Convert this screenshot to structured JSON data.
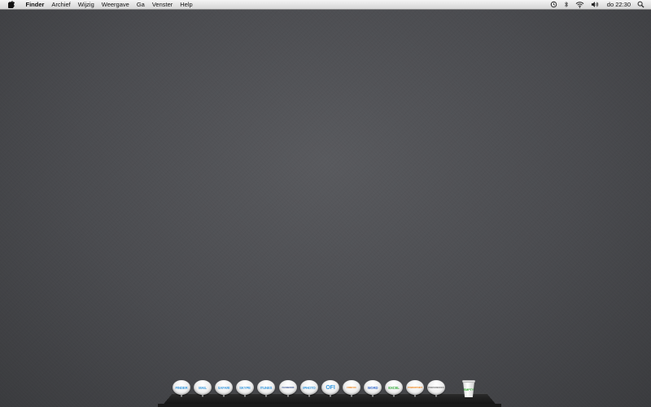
{
  "menubar": {
    "app_name": "Finder",
    "items": [
      "Archief",
      "Wijzig",
      "Weergave",
      "Ga",
      "Venster",
      "Help"
    ],
    "clock": "do 22:30",
    "status_icons": [
      "time-machine-icon",
      "bluetooth-icon",
      "wifi-icon",
      "volume-icon",
      "spotlight-icon"
    ]
  },
  "dock": {
    "icons": [
      {
        "label": "FINDER",
        "color": "#3a9be0"
      },
      {
        "label": "MAIL",
        "color": "#3a9be0"
      },
      {
        "label": "SAFARI",
        "color": "#3a9be0"
      },
      {
        "label": "SKYPE",
        "color": "#3a9be0"
      },
      {
        "label": "ITUNES",
        "color": "#3a9be0"
      },
      {
        "label": "FACEBOOK",
        "color": "#3b5998"
      },
      {
        "label": "IPHOTO",
        "color": "#3a9be0"
      },
      {
        "label": "OFI",
        "color": "#3a9be0"
      },
      {
        "label": "FIREFOX",
        "color": "#f08a24"
      },
      {
        "label": "WORD",
        "color": "#3a6fd0"
      },
      {
        "label": "EXCEL",
        "color": "#2ea836"
      },
      {
        "label": "POWERPOINT",
        "color": "#f08a24"
      },
      {
        "label": "PREFERENCES",
        "color": "#777777"
      }
    ],
    "trash_label": "EMPTY",
    "trash_color": "#2da82d"
  }
}
